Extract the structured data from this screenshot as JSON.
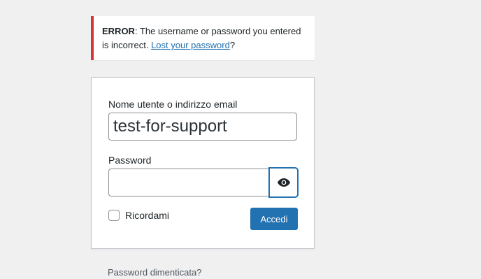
{
  "error_notice": {
    "label": "ERROR",
    "message": ": The username or password you entered is incorrect. ",
    "link_text": "Lost your password",
    "trailing": "?",
    "accent_color": "#d63638"
  },
  "login_form": {
    "username_label": "Nome utente o indirizzo email",
    "username_value": "test-for-support",
    "password_label": "Password",
    "password_value": "",
    "toggle_icon": "eye-icon",
    "remember_label": "Ricordami",
    "remember_checked": false,
    "submit_label": "Accedi",
    "submit_color": "#2271b1"
  },
  "footer": {
    "lost_password": "Password dimenticata?"
  }
}
